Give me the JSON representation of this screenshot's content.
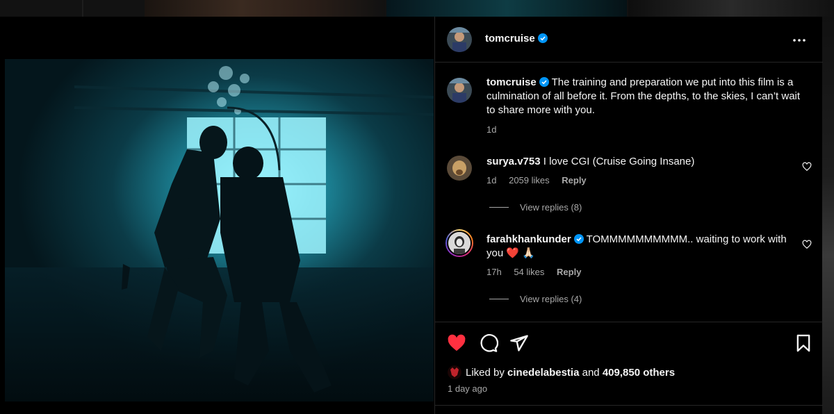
{
  "post": {
    "username": "tomcruise",
    "caption_user": "tomcruise",
    "caption": "The training and preparation we put into this film is a culmination of all before it. From the depths, to the skies, I can’t wait to share more with you.",
    "caption_time": "1d"
  },
  "comments": [
    {
      "username": "surya.v753",
      "text": "I love CGI (Cruise Going Insane)",
      "time": "1d",
      "likes": "2059 likes",
      "reply_label": "Reply",
      "view_replies": "View replies (8)"
    },
    {
      "username": "farahkhankunder",
      "text": "TOMMMMMMMMMM.. waiting to work with you ❤️ 🙏🏻",
      "time": "17h",
      "likes": "54 likes",
      "reply_label": "Reply",
      "view_replies": "View replies (4)"
    }
  ],
  "actions": {
    "liked_by_prefix": "Liked by",
    "liked_by_user": "cinedelabestia",
    "liked_by_mid": "and",
    "liked_by_count": "409,850 others",
    "posted": "1 day ago"
  },
  "background": {
    "left_fragment": "n"
  },
  "icons": {
    "more": "more-horizontal-icon",
    "verified": "verified-badge-icon",
    "like": "heart-filled-icon",
    "comment": "comment-bubble-icon",
    "share": "paper-plane-icon",
    "save": "bookmark-icon"
  },
  "colors": {
    "verified": "#0095f6",
    "like_red": "#ff3040",
    "muted_text": "#a8a8a8",
    "divider": "#262626"
  }
}
